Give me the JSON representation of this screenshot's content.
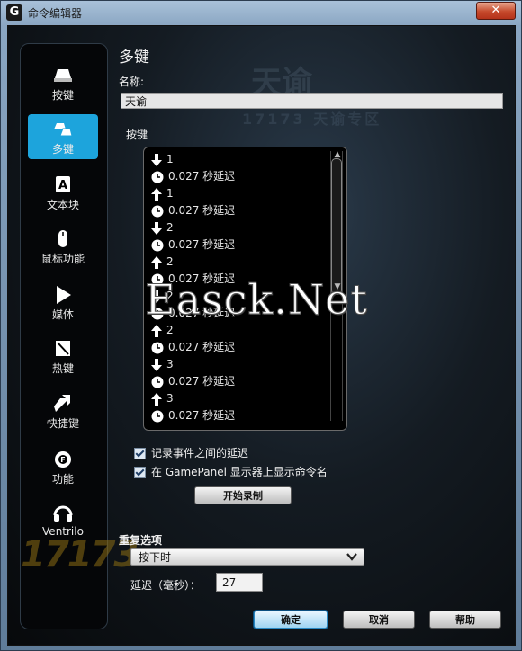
{
  "window": {
    "logo_letter": "G",
    "title": "命令编辑器",
    "close_glyph": "✕"
  },
  "sidebar": {
    "items": [
      {
        "label": "按键",
        "icon": "keycap-icon",
        "active": false
      },
      {
        "label": "多键",
        "icon": "multikey-icon",
        "active": true
      },
      {
        "label": "文本块",
        "icon": "text-block-icon",
        "active": false
      },
      {
        "label": "鼠标功能",
        "icon": "mouse-icon",
        "active": false
      },
      {
        "label": "媒体",
        "icon": "play-icon",
        "active": false
      },
      {
        "label": "热键",
        "icon": "hotkey-icon",
        "active": false
      },
      {
        "label": "快捷键",
        "icon": "shortcut-arrow-icon",
        "active": false
      },
      {
        "label": "功能",
        "icon": "function-gear-icon",
        "active": false
      },
      {
        "label": "Ventrilo",
        "icon": "headset-icon",
        "active": false
      }
    ]
  },
  "main": {
    "section_title": "多键",
    "name_label": "名称:",
    "name_value": "天谕",
    "keys_label": "按键",
    "events": [
      {
        "type": "down",
        "text": "1"
      },
      {
        "type": "delay",
        "text": "0.027 秒延迟"
      },
      {
        "type": "up",
        "text": "1"
      },
      {
        "type": "delay",
        "text": "0.027 秒延迟"
      },
      {
        "type": "down",
        "text": "2"
      },
      {
        "type": "delay",
        "text": "0.027 秒延迟"
      },
      {
        "type": "up",
        "text": "2"
      },
      {
        "type": "delay",
        "text": "0.027 秒延迟"
      },
      {
        "type": "down",
        "text": "2"
      },
      {
        "type": "delay",
        "text": "0.027 秒延迟"
      },
      {
        "type": "up",
        "text": "2"
      },
      {
        "type": "delay",
        "text": "0.027 秒延迟"
      },
      {
        "type": "down",
        "text": "3"
      },
      {
        "type": "delay",
        "text": "0.027 秒延迟"
      },
      {
        "type": "up",
        "text": "3"
      },
      {
        "type": "delay",
        "text": "0.027 秒延迟"
      }
    ],
    "checkbox_record_delay": {
      "label": "记录事件之间的延迟",
      "checked": true
    },
    "checkbox_show_name": {
      "label": "在 GamePanel 显示器上显示命令名",
      "checked": true
    },
    "record_button": "开始录制",
    "repeat_label": "重复选项",
    "repeat_value": "按下时",
    "delay_label": "延迟（毫秒）：",
    "delay_value": "27"
  },
  "footer": {
    "ok": "确定",
    "cancel": "取消",
    "help": "帮助"
  },
  "watermarks": {
    "overlay": "Easck.Net",
    "corner_logo": "17173",
    "game_logo": "天谕",
    "banner": "17173 天谕专区"
  },
  "colors": {
    "accent": "#1da4dc",
    "background": "#07090b",
    "close": "#c64a2c"
  }
}
